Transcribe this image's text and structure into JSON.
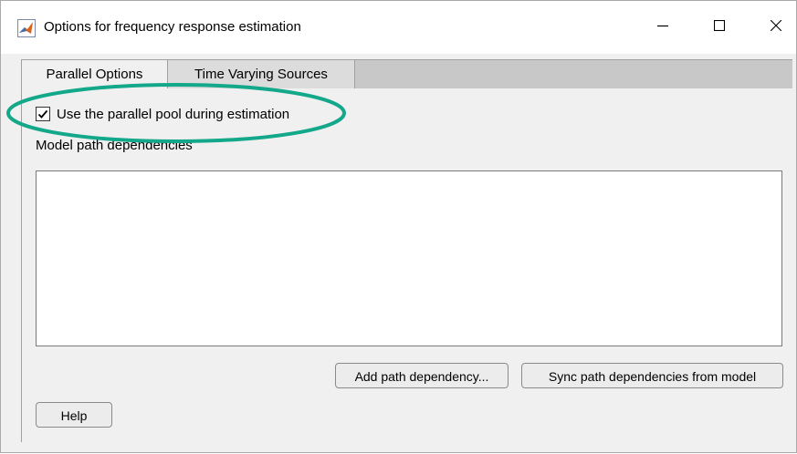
{
  "window": {
    "title": "Options for frequency response estimation",
    "app_icon": "matlab-logo-icon",
    "controls": {
      "minimize_icon": "minimize-icon",
      "maximize_icon": "maximize-icon",
      "close_icon": "close-icon"
    }
  },
  "tabs": [
    {
      "label": "Parallel Options",
      "selected": true
    },
    {
      "label": "Time Varying Sources",
      "selected": false
    }
  ],
  "parallel_options": {
    "use_parallel_pool": {
      "label": "Use the parallel pool during estimation",
      "checked": true
    },
    "model_path_label": "Model path dependencies",
    "model_path_items": [],
    "add_button_label": "Add path dependency...",
    "sync_button_label": "Sync path dependencies from model"
  },
  "help_button_label": "Help",
  "colors": {
    "highlight_ring": "#13a88a",
    "window_background": "#f0f0f0",
    "tab_strip": "#c8c8c8"
  }
}
